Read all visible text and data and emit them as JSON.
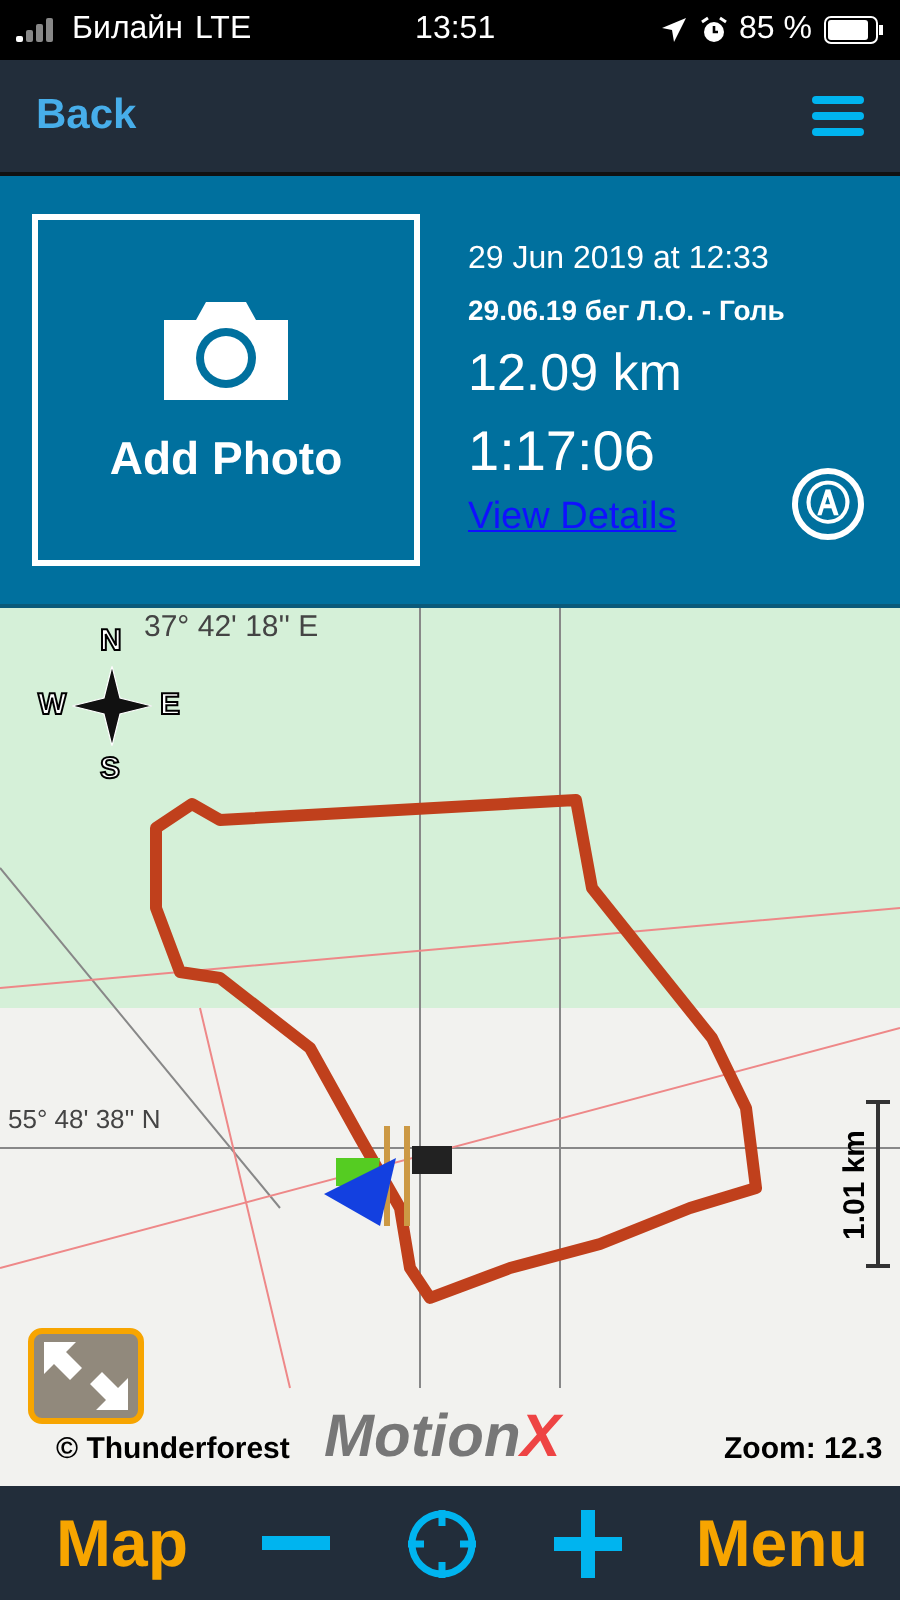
{
  "status_bar": {
    "carrier": "Билайн",
    "network": "LTE",
    "time": "13:51",
    "battery": "85 %"
  },
  "nav": {
    "back": "Back"
  },
  "activity": {
    "photo_label": "Add Photo",
    "date": "29 Jun 2019 at 12:33",
    "name": "29.06.19 бег Л.О. - Голь",
    "distance": "12.09 km",
    "duration": "1:17:06",
    "details_link": "View Details",
    "badge": "Ⓐ"
  },
  "map": {
    "longitude": "37° 42' 18'' E",
    "latitude": "55° 48' 38'' N",
    "compass": {
      "n": "N",
      "s": "S",
      "w": "W",
      "e": "E"
    },
    "scale": "1.01 km",
    "attribution": "© Thunderforest",
    "logo": {
      "first": "Motion",
      "last": "X"
    },
    "zoom": "Zoom: 12.3"
  },
  "toolbar": {
    "left": "Map",
    "right": "Menu"
  }
}
